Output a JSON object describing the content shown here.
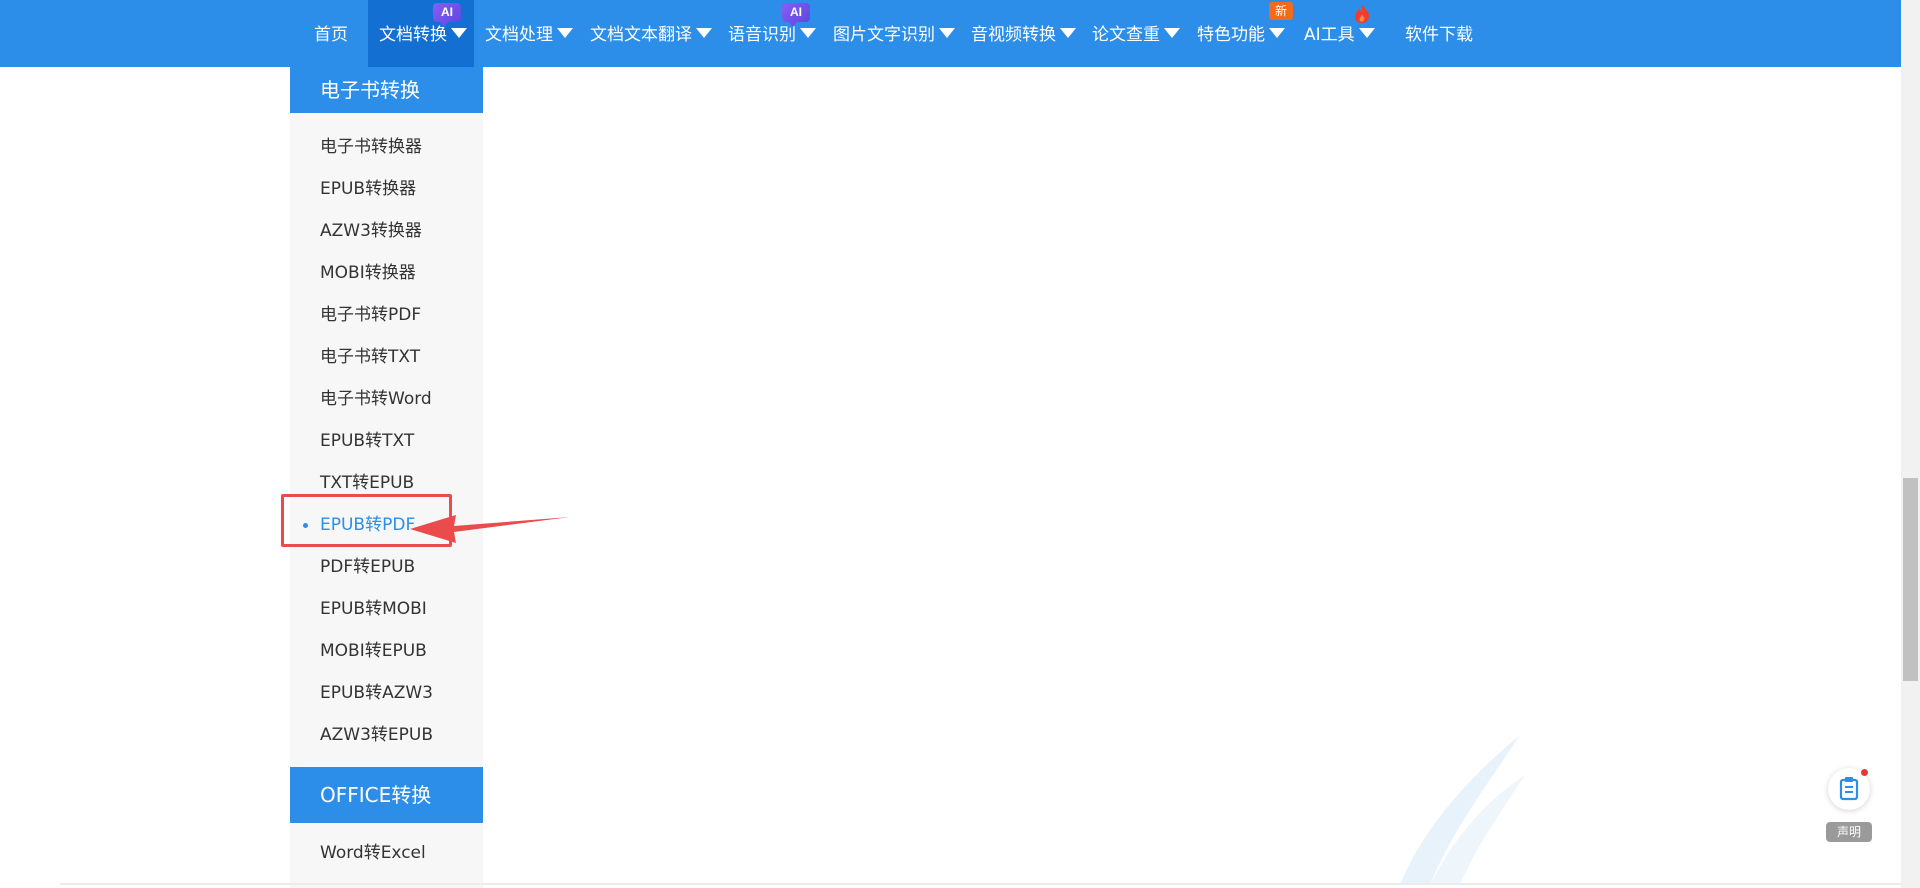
{
  "nav": {
    "items": [
      {
        "label": "首页"
      },
      {
        "label": "文档转换",
        "badge": "AI"
      },
      {
        "label": "文档处理"
      },
      {
        "label": "文档文本翻译"
      },
      {
        "label": "语音识别",
        "badge": "AI"
      },
      {
        "label": "图片文字识别"
      },
      {
        "label": "音视频转换"
      },
      {
        "label": "论文查重"
      },
      {
        "label": "特色功能",
        "badge": "新"
      },
      {
        "label": "AI工具",
        "icon": "fire-icon"
      },
      {
        "label": "软件下载"
      }
    ]
  },
  "sidebar": {
    "section1_title": "电子书转换",
    "section1_items": [
      "电子书转换器",
      "EPUB转换器",
      "AZW3转换器",
      "MOBI转换器",
      "电子书转PDF",
      "电子书转TXT",
      "电子书转Word",
      "EPUB转TXT",
      "TXT转EPUB",
      "EPUB转PDF",
      "PDF转EPUB",
      "EPUB转MOBI",
      "MOBI转EPUB",
      "EPUB转AZW3",
      "AZW3转EPUB"
    ],
    "active_item": "EPUB转PDF",
    "section2_title": "OFFICE转换",
    "section2_items": [
      "Word转Excel"
    ]
  },
  "widget": {
    "label": "声明",
    "icon": "clipboard-icon"
  },
  "colors": {
    "primary": "#2c8ee8",
    "nav_active": "#136fd1",
    "annotation": "#ec4b4b"
  }
}
